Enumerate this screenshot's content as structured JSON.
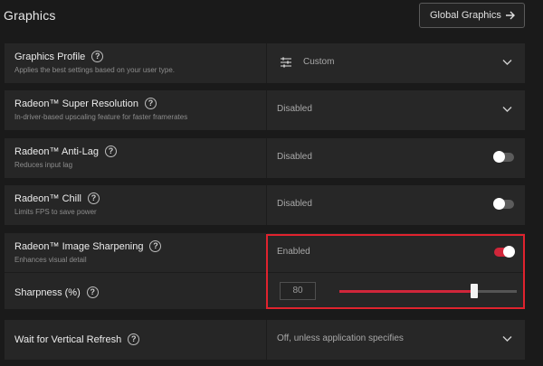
{
  "header": {
    "title": "Graphics",
    "global_button_label": "Global Graphics",
    "global_button_icon": "arrow-right-icon"
  },
  "rows": {
    "profile": {
      "title": "Graphics Profile",
      "subtitle": "Applies the best settings based on your user type.",
      "value": "Custom",
      "icon": "sliders-icon",
      "control": "dropdown"
    },
    "super_resolution": {
      "title": "Radeon™ Super Resolution",
      "subtitle": "In-driver-based upscaling feature for faster framerates",
      "value": "Disabled",
      "control": "dropdown"
    },
    "anti_lag": {
      "title": "Radeon™ Anti-Lag",
      "subtitle": "Reduces input lag",
      "value": "Disabled",
      "toggle_on": false
    },
    "chill": {
      "title": "Radeon™ Chill",
      "subtitle": "Limits FPS to save power",
      "value": "Disabled",
      "toggle_on": false
    },
    "image_sharpening": {
      "title": "Radeon™ Image Sharpening",
      "subtitle": "Enhances visual detail",
      "value": "Enabled",
      "toggle_on": true
    },
    "sharpness": {
      "title": "Sharpness (%)",
      "value": "80",
      "slider_fraction": 0.77
    },
    "vsync": {
      "title": "Wait for Vertical Refresh",
      "value": "Off, unless application specifies",
      "control": "dropdown"
    }
  },
  "colors": {
    "accent": "#d0263a",
    "highlight_border": "#e0232e",
    "background": "#1a1a1a",
    "row_background": "#262626"
  }
}
